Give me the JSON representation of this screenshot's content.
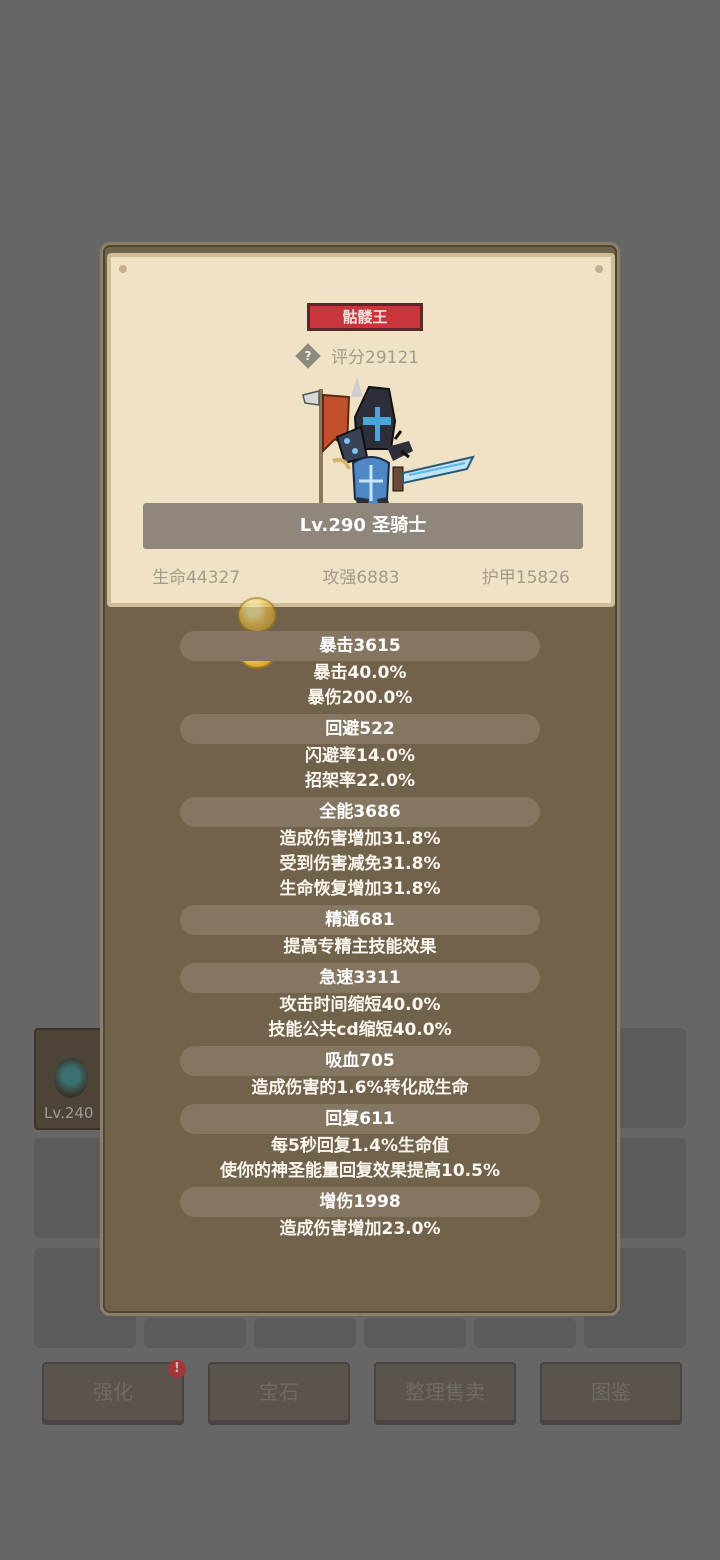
{
  "background": {
    "item_level": "Lv.240",
    "buttons": [
      {
        "label": "强化",
        "alert": "!"
      },
      {
        "label": "宝石"
      },
      {
        "label": "整理售卖"
      },
      {
        "label": "图鉴"
      }
    ]
  },
  "hero_panel": {
    "boss_name": "骷髅王",
    "help_icon": "question-icon",
    "score_label": "评分29121",
    "hero_title": "Lv.290 圣骑士",
    "stats": [
      {
        "label": "生命44327"
      },
      {
        "label": "攻强6883"
      },
      {
        "label": "护甲15826"
      }
    ]
  },
  "attributes": [
    {
      "title": "暴击3615",
      "lines": [
        "暴击40.0%",
        "暴伤200.0%"
      ]
    },
    {
      "title": "回避522",
      "lines": [
        "闪避率14.0%",
        "招架率22.0%"
      ]
    },
    {
      "title": "全能3686",
      "lines": [
        "造成伤害增加31.8%",
        "受到伤害减免31.8%",
        "生命恢复增加31.8%"
      ]
    },
    {
      "title": "精通681",
      "lines": [
        "提高专精主技能效果"
      ]
    },
    {
      "title": "急速3311",
      "lines": [
        "攻击时间缩短40.0%",
        "技能公共cd缩短40.0%"
      ]
    },
    {
      "title": "吸血705",
      "lines": [
        "造成伤害的1.6%转化成生命"
      ]
    },
    {
      "title": "回复611",
      "lines": [
        "每5秒回复1.4%生命值",
        "使你的神圣能量回复效果提高10.5%"
      ]
    },
    {
      "title": "增伤1998",
      "lines": [
        "造成伤害增加23.0%"
      ]
    }
  ]
}
